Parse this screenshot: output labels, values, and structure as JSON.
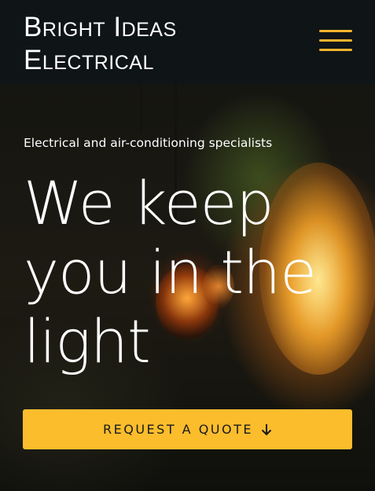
{
  "header": {
    "brand_line1": "Bright Ideas",
    "brand_line2": "Electrical",
    "menu_icon": "hamburger-menu-icon",
    "accent_color": "#f7b42c"
  },
  "hero": {
    "subtitle": "Electrical and air-conditioning specialists",
    "headline_line1": "We keep",
    "headline_highlight": "you",
    "headline_line2_rest": " in the",
    "headline_line3": "light",
    "cta_label": "REQUEST A QUOTE",
    "cta_icon": "arrow-down-icon",
    "cta_color": "#fbbd2c"
  }
}
